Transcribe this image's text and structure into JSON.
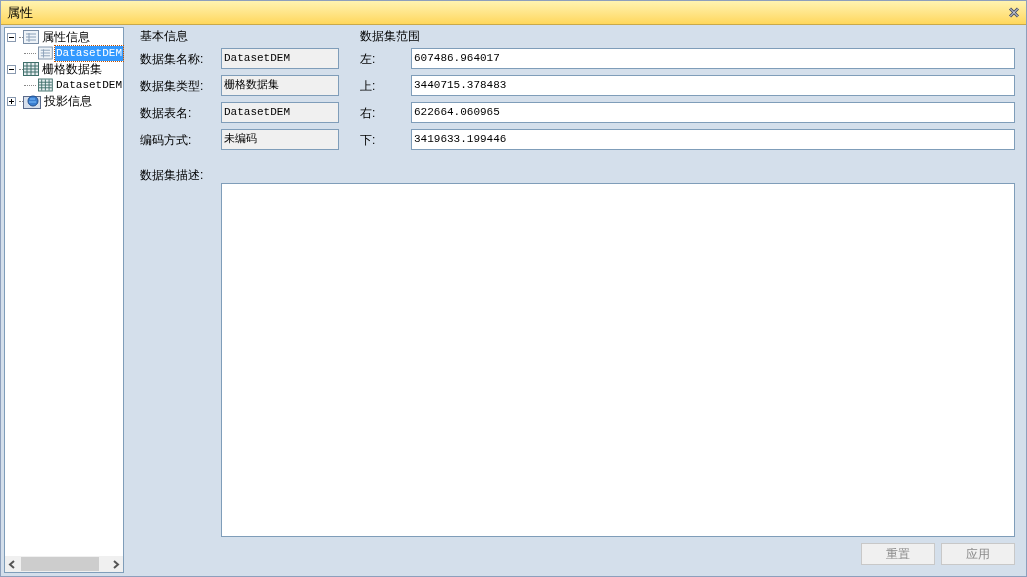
{
  "window": {
    "title": "属性"
  },
  "tree": [
    {
      "label": "属性信息",
      "kind": "attribute",
      "expanded": true,
      "selected": false,
      "children": [
        {
          "label": "DatasetDEM",
          "kind": "attribute",
          "selected": true
        }
      ]
    },
    {
      "label": "栅格数据集",
      "kind": "grid",
      "expanded": true,
      "selected": false,
      "children": [
        {
          "label": "DatasetDEM",
          "kind": "grid",
          "selected": false
        }
      ]
    },
    {
      "label": "投影信息",
      "kind": "projection",
      "expanded": false,
      "selected": false
    }
  ],
  "basic_info": {
    "title": "基本信息",
    "fields": [
      {
        "label": "数据集名称:",
        "value": "DatasetDEM"
      },
      {
        "label": "数据集类型:",
        "value": "栅格数据集"
      },
      {
        "label": "数据表名:",
        "value": "DatasetDEM"
      },
      {
        "label": "编码方式:",
        "value": "未编码"
      }
    ]
  },
  "extent": {
    "title": "数据集范围",
    "fields": [
      {
        "label": "左:",
        "value": "607486.964017"
      },
      {
        "label": "上:",
        "value": "3440715.378483"
      },
      {
        "label": "右:",
        "value": "622664.060965"
      },
      {
        "label": "下:",
        "value": "3419633.199446"
      }
    ]
  },
  "description": {
    "label": "数据集描述:"
  },
  "buttons": [
    {
      "label": "重置",
      "disabled": true
    },
    {
      "label": "应用",
      "disabled": true
    }
  ]
}
